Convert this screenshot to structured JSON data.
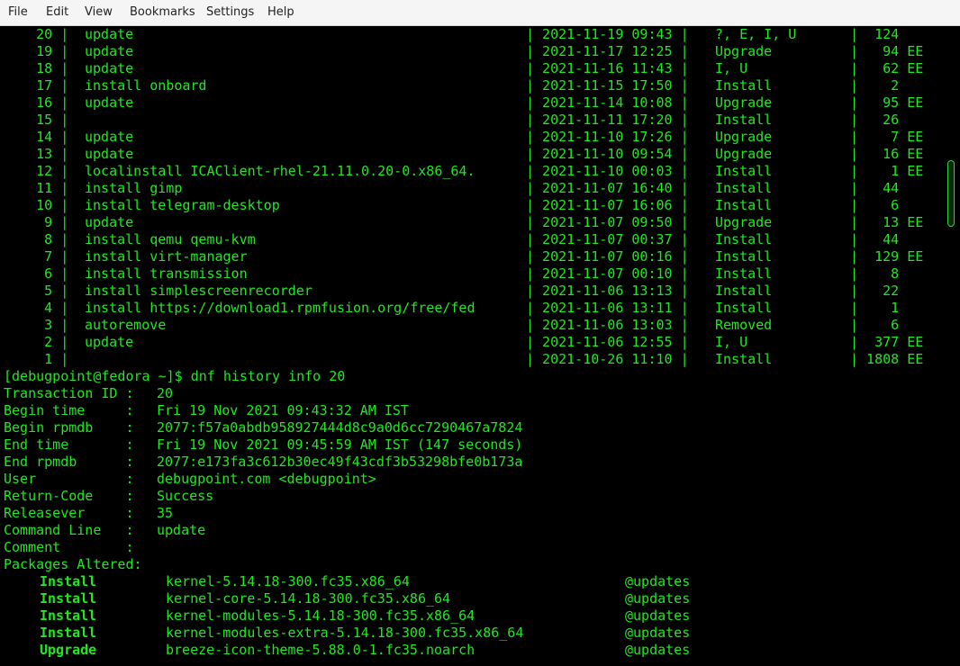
{
  "menu": [
    "File",
    "Edit",
    "View",
    "Bookmarks",
    "Settings",
    "Help"
  ],
  "history_rows": [
    {
      "id": "20",
      "cmd": "update",
      "date": "2021-11-19 09:43",
      "action": "?, E, I, U",
      "altered": " 124",
      "flag": ""
    },
    {
      "id": "19",
      "cmd": "update",
      "date": "2021-11-17 12:25",
      "action": "Upgrade",
      "altered": "  94",
      "flag": "EE"
    },
    {
      "id": "18",
      "cmd": "update",
      "date": "2021-11-16 11:43",
      "action": "I, U",
      "altered": "  62",
      "flag": "EE"
    },
    {
      "id": "17",
      "cmd": "install onboard",
      "date": "2021-11-15 17:50",
      "action": "Install",
      "altered": "   2",
      "flag": ""
    },
    {
      "id": "16",
      "cmd": "update",
      "date": "2021-11-14 10:08",
      "action": "Upgrade",
      "altered": "  95",
      "flag": "EE"
    },
    {
      "id": "15",
      "cmd": "",
      "date": "2021-11-11 17:20",
      "action": "Install",
      "altered": "  26",
      "flag": ""
    },
    {
      "id": "14",
      "cmd": "update",
      "date": "2021-11-10 17:26",
      "action": "Upgrade",
      "altered": "   7",
      "flag": "EE"
    },
    {
      "id": "13",
      "cmd": "update",
      "date": "2021-11-10 09:54",
      "action": "Upgrade",
      "altered": "  16",
      "flag": "EE"
    },
    {
      "id": "12",
      "cmd": "localinstall ICAClient-rhel-21.11.0.20-0.x86_64.",
      "date": "2021-11-10 00:03",
      "action": "Install",
      "altered": "   1",
      "flag": "EE"
    },
    {
      "id": "11",
      "cmd": "install gimp",
      "date": "2021-11-07 16:40",
      "action": "Install",
      "altered": "  44",
      "flag": ""
    },
    {
      "id": "10",
      "cmd": "install telegram-desktop",
      "date": "2021-11-07 16:06",
      "action": "Install",
      "altered": "   6",
      "flag": ""
    },
    {
      "id": "9",
      "cmd": "update",
      "date": "2021-11-07 09:50",
      "action": "Upgrade",
      "altered": "  13",
      "flag": "EE"
    },
    {
      "id": "8",
      "cmd": "install qemu qemu-kvm",
      "date": "2021-11-07 00:37",
      "action": "Install",
      "altered": "  44",
      "flag": ""
    },
    {
      "id": "7",
      "cmd": "install virt-manager",
      "date": "2021-11-07 00:16",
      "action": "Install",
      "altered": " 129",
      "flag": "EE"
    },
    {
      "id": "6",
      "cmd": "install transmission",
      "date": "2021-11-07 00:10",
      "action": "Install",
      "altered": "   8",
      "flag": ""
    },
    {
      "id": "5",
      "cmd": "install simplescreenrecorder",
      "date": "2021-11-06 13:13",
      "action": "Install",
      "altered": "  22",
      "flag": ""
    },
    {
      "id": "4",
      "cmd": "install https://download1.rpmfusion.org/free/fed",
      "date": "2021-11-06 13:11",
      "action": "Install",
      "altered": "   1",
      "flag": ""
    },
    {
      "id": "3",
      "cmd": "autoremove",
      "date": "2021-11-06 13:03",
      "action": "Removed",
      "altered": "   6",
      "flag": ""
    },
    {
      "id": "2",
      "cmd": "update",
      "date": "2021-11-06 12:55",
      "action": "I, U",
      "altered": " 377",
      "flag": "EE"
    },
    {
      "id": "1",
      "cmd": "",
      "date": "2021-10-26 11:10",
      "action": "Install",
      "altered": "1808",
      "flag": "EE"
    }
  ],
  "prompt_line": "[debugpoint@fedora ~]$ dnf history info 20",
  "info_rows": [
    {
      "key": "Transaction ID",
      "value": "20"
    },
    {
      "key": "Begin time",
      "value": "Fri 19 Nov 2021 09:43:32 AM IST"
    },
    {
      "key": "Begin rpmdb",
      "value": "2077:f57a0abdb958927444d8c9a0d6cc7290467a7824"
    },
    {
      "key": "End time",
      "value": "Fri 19 Nov 2021 09:45:59 AM IST (147 seconds)"
    },
    {
      "key": "End rpmdb",
      "value": "2077:e173fa3c612b30ec49f43cdf3b53298bfe0b173a"
    },
    {
      "key": "User",
      "value": "debugpoint.com <debugpoint>"
    },
    {
      "key": "Return-Code",
      "value": "Success"
    },
    {
      "key": "Releasever",
      "value": "35"
    },
    {
      "key": "Command Line",
      "value": "update"
    },
    {
      "key": "Comment",
      "value": ""
    }
  ],
  "packages_label": "Packages Altered:",
  "packages": [
    {
      "action": "Install",
      "name": "kernel-5.14.18-300.fc35.x86_64",
      "repo": "@updates"
    },
    {
      "action": "Install",
      "name": "kernel-core-5.14.18-300.fc35.x86_64",
      "repo": "@updates"
    },
    {
      "action": "Install",
      "name": "kernel-modules-5.14.18-300.fc35.x86_64",
      "repo": "@updates"
    },
    {
      "action": "Install",
      "name": "kernel-modules-extra-5.14.18-300.fc35.x86_64",
      "repo": "@updates"
    },
    {
      "action": "Upgrade",
      "name": "breeze-icon-theme-5.88.0-1.fc35.noarch",
      "repo": "@updates"
    }
  ],
  "colors": {
    "terminal_text": "#1ee81e",
    "terminal_bg": "#000000",
    "menubar_bg": "#f5f5f5"
  }
}
